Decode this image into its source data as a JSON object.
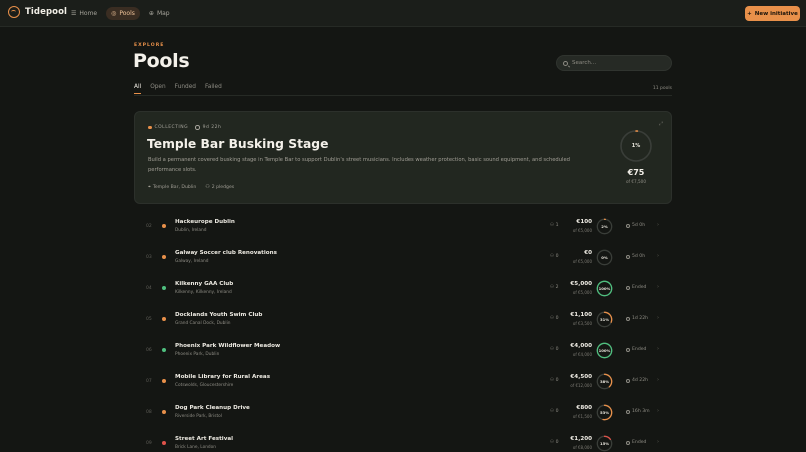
{
  "app": {
    "name": "Tidepool",
    "new_button": "New initiative",
    "new_icon": "plus-icon"
  },
  "nav": [
    {
      "label": "Home",
      "icon": "home-icon",
      "glyph": "☰",
      "active": false
    },
    {
      "label": "Pools",
      "icon": "pools-icon",
      "glyph": "◎",
      "active": true
    },
    {
      "label": "Map",
      "icon": "globe-icon",
      "glyph": "⊕",
      "active": false
    }
  ],
  "header": {
    "eyebrow": "EXPLORE",
    "title": "Pools",
    "search_placeholder": "Search..."
  },
  "tabs": [
    {
      "label": "All",
      "active": true
    },
    {
      "label": "Open",
      "active": false
    },
    {
      "label": "Funded",
      "active": false
    },
    {
      "label": "Failed",
      "active": false
    }
  ],
  "pool_count": "11 pools",
  "featured": {
    "status": "COLLECTING",
    "time_left": "9d 22h",
    "title": "Temple Bar Busking Stage",
    "description": "Build a permanent covered busking stage in Temple Bar to support Dublin's street musicians. Includes weather protection, basic sound equipment, and scheduled performance slots.",
    "location": "Temple Bar, Dublin",
    "pledges": "2 pledges",
    "percent_label": "1%",
    "progress": 0.01,
    "amount": "€75",
    "goal": "of €7,500",
    "ring_color": "#e8904a"
  },
  "colors": {
    "accent": "#e8904a",
    "collecting": "#e8904a",
    "funded": "#4fbf7f",
    "failed": "#e0534a"
  },
  "rows": [
    {
      "idx": "02",
      "name": "Hackeurope Dublin",
      "loc": "Dublin, Ireland",
      "pledges": "1",
      "amount": "€100",
      "goal": "of €5,000",
      "pct": "2%",
      "progress": 0.02,
      "time": "5d 0h",
      "status": "collecting"
    },
    {
      "idx": "03",
      "name": "Galway Soccer club Renovations",
      "loc": "Galway, Ireland",
      "pledges": "0",
      "amount": "€0",
      "goal": "of €5,000",
      "pct": "0%",
      "progress": 0.0,
      "time": "5d 0h",
      "status": "collecting"
    },
    {
      "idx": "04",
      "name": "Kilkenny GAA Club",
      "loc": "Kilkenny, Kilkenny, Ireland",
      "pledges": "2",
      "amount": "€5,000",
      "goal": "of €5,000",
      "pct": "100%",
      "progress": 1.0,
      "time": "Ended",
      "status": "funded"
    },
    {
      "idx": "05",
      "name": "Docklands Youth Swim Club",
      "loc": "Grand Canal Dock, Dublin",
      "pledges": "0",
      "amount": "€1,100",
      "goal": "of €3,500",
      "pct": "31%",
      "progress": 0.31,
      "time": "1d 22h",
      "status": "collecting"
    },
    {
      "idx": "06",
      "name": "Phoenix Park Wildflower Meadow",
      "loc": "Phoenix Park, Dublin",
      "pledges": "0",
      "amount": "€4,000",
      "goal": "of €4,000",
      "pct": "100%",
      "progress": 1.0,
      "time": "Ended",
      "status": "funded"
    },
    {
      "idx": "07",
      "name": "Mobile Library for Rural Areas",
      "loc": "Cotswolds, Gloucestershire",
      "pledges": "0",
      "amount": "€4,500",
      "goal": "of €12,000",
      "pct": "38%",
      "progress": 0.38,
      "time": "4d 22h",
      "status": "collecting"
    },
    {
      "idx": "08",
      "name": "Dog Park Cleanup Drive",
      "loc": "Riverside Park, Bristol",
      "pledges": "0",
      "amount": "€800",
      "goal": "of €1,500",
      "pct": "53%",
      "progress": 0.53,
      "time": "16h 3m",
      "status": "collecting"
    },
    {
      "idx": "09",
      "name": "Street Art Festival",
      "loc": "Brick Lane, London",
      "pledges": "0",
      "amount": "€1,200",
      "goal": "of €8,000",
      "pct": "15%",
      "progress": 0.15,
      "time": "Ended",
      "status": "failed"
    }
  ]
}
